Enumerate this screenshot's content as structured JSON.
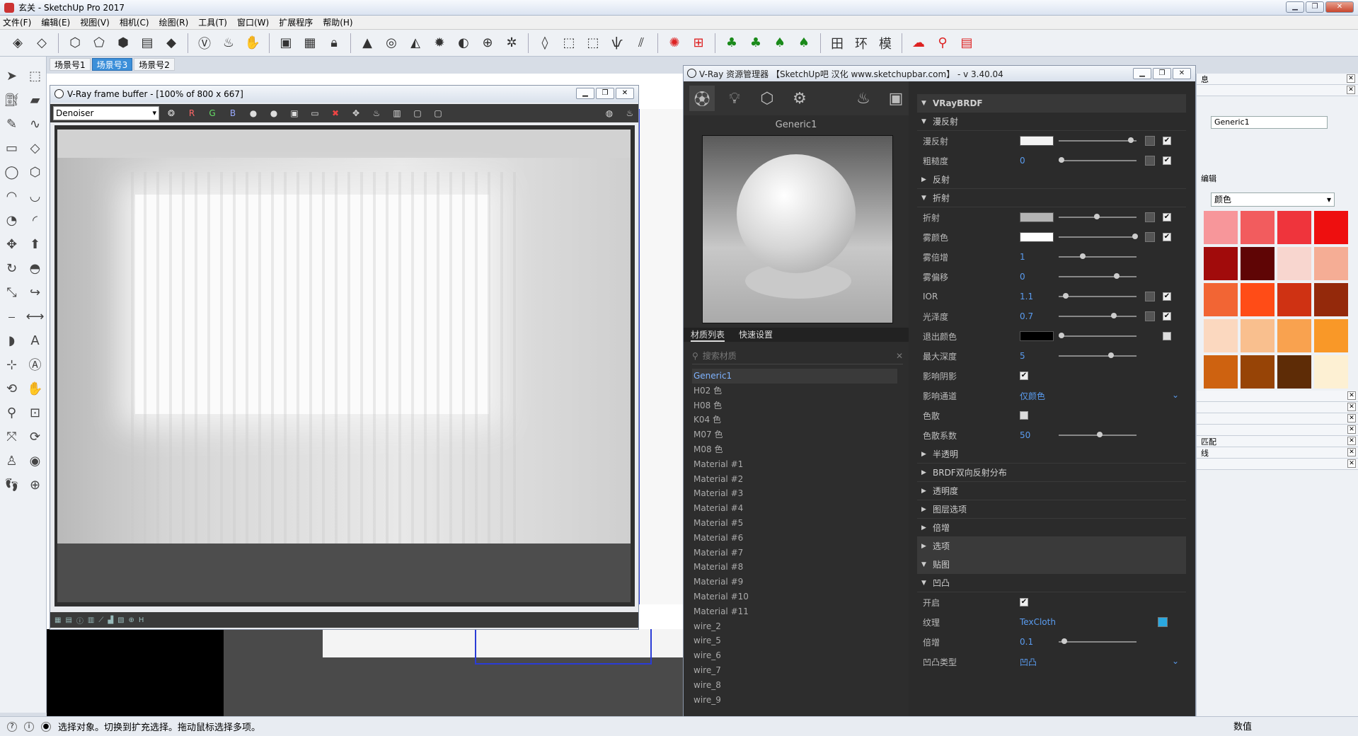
{
  "window": {
    "title": "玄关 - SketchUp Pro 2017"
  },
  "menu": [
    "文件(F)",
    "编辑(E)",
    "视图(V)",
    "相机(C)",
    "绘图(R)",
    "工具(T)",
    "窗口(W)",
    "扩展程序",
    "帮助(H)"
  ],
  "toolbar_icons": [
    "box-icon",
    "erase-icon",
    "paint-icon",
    "wire-icon",
    "hidden-icon",
    "shaded-icon",
    "layers-icon",
    "iso-icon",
    "vray-icon",
    "teapot-icon",
    "interactive-icon",
    "frame-icon",
    "vfb-icon",
    "lock-icon",
    "cap-icon",
    "sphere-icon",
    "cone-icon",
    "sun-icon",
    "dome-icon",
    "globe-icon",
    "gear-icon",
    "plane-icon",
    "box-tool-icon",
    "grass-icon",
    "brush-icon",
    "fur-icon",
    "red-gear-icon",
    "grid-icon",
    "tree-icon",
    "tree2-icon",
    "tree3-icon",
    "plan-icon",
    "ring-icon",
    "model-icon",
    "cloud-icon",
    "pin-icon",
    "doc-icon"
  ],
  "scene_tabs": [
    "场景号1",
    "场景号3",
    "场景号2"
  ],
  "active_scene": 1,
  "vfb": {
    "title": "V-Ray frame buffer - [100% of 800 x 667]",
    "channel": "Denoiser",
    "r": "R",
    "g": "G",
    "b": "B"
  },
  "vray": {
    "title": "V-Ray 资源管理器 【SketchUp吧 汉化 www.sketchupbar.com】 - v 3.40.04",
    "material_name": "Generic1",
    "tabs": [
      "材质列表",
      "快速设置"
    ],
    "search_placeholder": "搜索材质",
    "materials": [
      "Generic1",
      "H02 色",
      "H08 色",
      "K04 色",
      "M07 色",
      "M08 色",
      "Material #1",
      "Material #2",
      "Material #3",
      "Material #4",
      "Material #5",
      "Material #6",
      "Material #7",
      "Material #8",
      "Material #9",
      "Material #10",
      "Material #11",
      "wire_2",
      "wire_5",
      "wire_6",
      "wire_7",
      "wire_8",
      "wire_9"
    ],
    "brdf": {
      "header": "VRayBRDF",
      "diffuse_section": "漫反射",
      "diffuse": "漫反射",
      "roughness_label": "粗糙度",
      "roughness": "0",
      "reflection": "反射",
      "refraction_section": "折射",
      "refraction": "折射",
      "fog_color": "雾颜色",
      "fog_mult_label": "雾倍增",
      "fog_mult": "1",
      "fog_bias_label": "雾偏移",
      "fog_bias": "0",
      "ior_label": "IOR",
      "ior": "1.1",
      "gloss_label": "光泽度",
      "gloss": "0.7",
      "exit_color": "退出颜色",
      "max_depth_label": "最大深度",
      "max_depth": "5",
      "affect_shadows": "影响阴影",
      "affect_channels_label": "影响通道",
      "affect_channels": "仅颜色",
      "dispersion": "色散",
      "dispersion_coef_label": "色散系数",
      "dispersion_coef": "50",
      "translucency": "半透明",
      "brdf_dist": "BRDF双向反射分布",
      "opacity": "透明度",
      "layer_opts": "图层选项",
      "multiplier": "倍增",
      "options": "选项",
      "maps": "贴图",
      "bump_section": "凹凸",
      "on_label": "开启",
      "texture_label": "纹理",
      "texture": "TexCloth",
      "bump_mult_label": "倍增",
      "bump_mult": "0.1",
      "bump_type_label": "凹凸类型",
      "bump_type": "凹凸"
    }
  },
  "tray": {
    "partial_label_1": "息",
    "name_value": "Generic1",
    "partial_label_2": "编辑",
    "color_mode": "颜色",
    "partial_label_3": "匹配",
    "partial_label_4": "线",
    "palette": [
      "#f7969a",
      "#f25c5e",
      "#ef343c",
      "#ee0f0f",
      "#a10b0b",
      "#5f0505",
      "#f8d6cf",
      "#f5ad95",
      "#f26534",
      "#ff4c17",
      "#cf3213",
      "#94290b",
      "#fbd8bf",
      "#f9bf8e",
      "#f9a24f",
      "#f99828",
      "#ce6210",
      "#974406",
      "#5e2c06",
      "#fdf0d3"
    ]
  },
  "status": {
    "text": "选择对象。切换到扩充选择。拖动鼠标选择多项。",
    "measure_label": "数值"
  }
}
